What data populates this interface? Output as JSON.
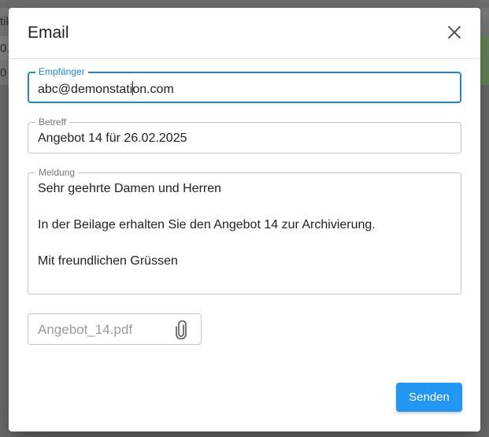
{
  "background": {
    "row1_fragment": "tik",
    "row2_fragment": "0.",
    "row3_fragment": "0"
  },
  "dialog": {
    "title": "Email",
    "close_icon": "close-icon",
    "recipient": {
      "label": "Empfänger",
      "value_before_caret": "abc@demonstati",
      "value_after_caret": "on.com"
    },
    "subject": {
      "label": "Betreff",
      "value": "Angebot 14 für 26.02.2025"
    },
    "message": {
      "label": "Meldung",
      "lines": [
        "Sehr geehrte Damen und Herren",
        "In der Beilage erhalten Sie den Angebot 14 zur Archivierung.",
        "Mit freundlichen Grüssen"
      ]
    },
    "attachment": {
      "file_name": "Angebot_14.pdf",
      "icon": "paperclip-icon"
    },
    "send_label": "Senden"
  },
  "colors": {
    "accent": "#2196f3",
    "focus_border": "#1e88c9"
  }
}
